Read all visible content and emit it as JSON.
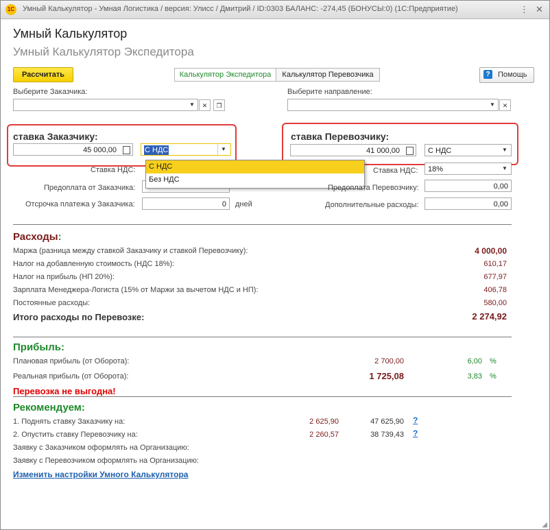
{
  "window": {
    "title": "Умный Калькулятор - Умная Логистика / версия: Улисс / Дмитрий / ID:0303 БАЛАНС: -274,45 (БОНУСЫ:0)  (1С:Предприятие)",
    "icon_text": "1С",
    "buttons": {
      "menu": "⋮",
      "close": "✕"
    }
  },
  "header": {
    "title": "Умный Калькулятор",
    "subtitle": "Умный Калькулятор Экспедитора"
  },
  "toolbar": {
    "calculate_label": "Рассчитать",
    "tabs": [
      "Калькулятор Экспедитора",
      "Калькулятор Перевозчика"
    ],
    "help_label": "Помощь",
    "help_icon": "?"
  },
  "customer": {
    "label": "Выберите Заказчика:",
    "value": ""
  },
  "direction": {
    "label": "Выберите направление:",
    "value": ""
  },
  "customer_rate": {
    "title": "ставка Заказчику:",
    "amount": "45 000,00",
    "vat_mode": "С НДС",
    "vat_rate_label": "Ставка НДС:",
    "prepay_label": "Предоплата от Заказчика:",
    "delay_label": "Отсрочка платежа у Заказчика:",
    "delay_value": "0",
    "delay_unit": "дней"
  },
  "dropdown_options": [
    "С НДС",
    "Без НДС"
  ],
  "carrier_rate": {
    "title": "ставка Перевозчику:",
    "amount": "41 000,00",
    "vat_mode": "С НДС",
    "vat_rate_label": "Ставка НДС:",
    "vat_rate_value": "18%",
    "prepay_label": "Предоплата Перевозчику:",
    "prepay_value": "0,00",
    "extra_label": "Дополнительные расходы:",
    "extra_value": "0,00"
  },
  "expenses": {
    "title": "Расходы",
    "colon": ":",
    "rows": [
      {
        "label": "Маржа (разница между ставкой Заказчику и ставкой Перевозчику):",
        "value": "4 000,00"
      },
      {
        "label": "Налог на добавленную стоимость (НДС 18%):",
        "value": "610,17"
      },
      {
        "label": "Налог на прибыль (НП 20%):",
        "value": "677,97"
      },
      {
        "label": "Зарплата Менеджера-Логиста (15% от Маржи за вычетом НДС и НП):",
        "value": "406,78"
      },
      {
        "label": "Постоянные расходы:",
        "value": "580,00"
      }
    ],
    "total_label": "Итого расходы по Перевозке:",
    "total_value": "2 274,92"
  },
  "profit": {
    "title": "Прибыль",
    "colon": ":",
    "planned_label": "Плановая прибыль (от Оборота):",
    "planned_value": "2 700,00",
    "planned_pct": "6,00",
    "real_label": "Реальная прибыль (от Оборота):",
    "real_value": "1 725,08",
    "real_pct": "3,83",
    "pct_sign": "%",
    "warning": "Перевозка не выгодна!"
  },
  "recommend": {
    "title": "Рекомендуем",
    "colon": ":",
    "rows": [
      {
        "label": "1. Поднять ставку Заказчику на:",
        "delta": "2 625,90",
        "result": "47 625,90",
        "help": "?"
      },
      {
        "label": "2. Опустить ставку Перевозчику на:",
        "delta": "2 260,57",
        "result": "38 739,43",
        "help": "?"
      }
    ],
    "org_customer_label": "Заявку с Заказчиком оформлять на Организацию:",
    "org_carrier_label": "Заявку с Перевозчиком оформлять на Организацию:",
    "settings_link": "Изменить настройки Умного Калькулятора"
  }
}
